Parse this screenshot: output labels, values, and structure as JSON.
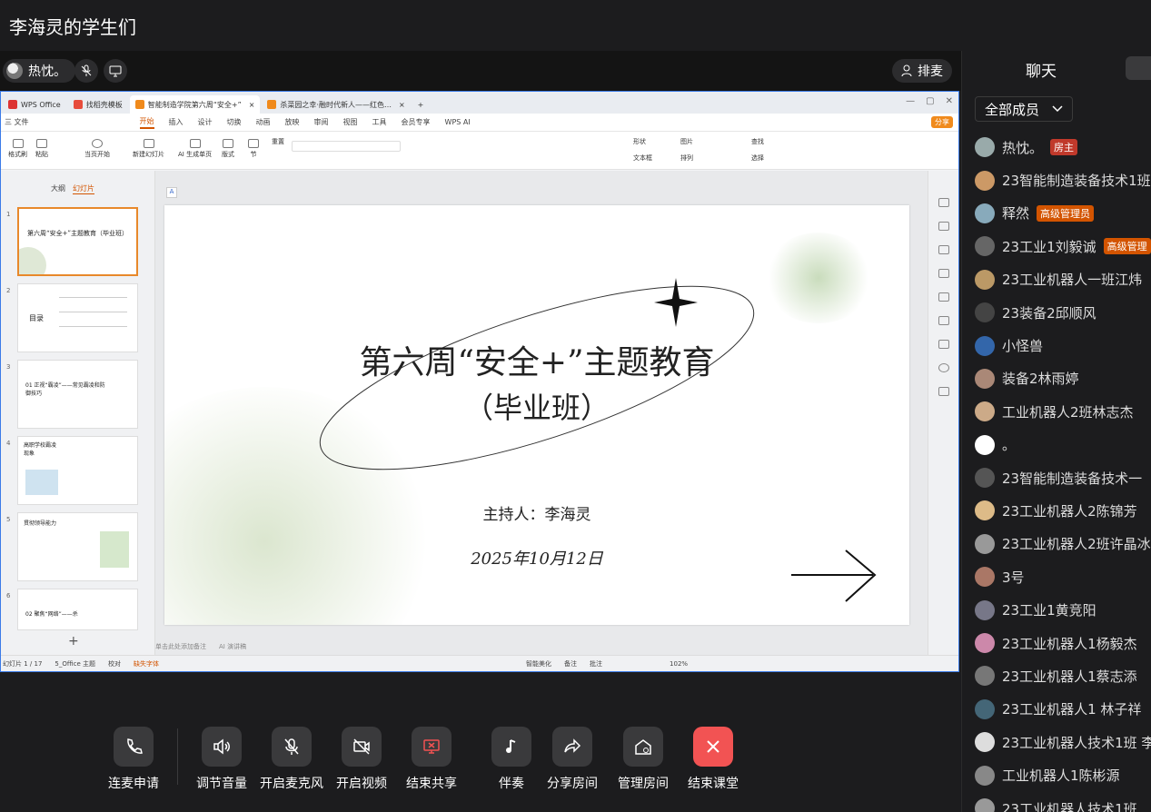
{
  "room": {
    "title": "李海灵的学生们"
  },
  "topbar": {
    "host_name": "热忱。",
    "queue_label": "排麦"
  },
  "wps": {
    "tabs": [
      {
        "label": "WPS Office",
        "color": "#d33"
      },
      {
        "label": "找稻壳模板",
        "color": "#e74c3c"
      },
      {
        "label": "智能制造学院第六周“安全+”",
        "color": "#f08a1c"
      },
      {
        "label": "杀菜园之幸·融时代新人——红色…",
        "color": "#f08a1c"
      }
    ],
    "menu": [
      "三 文件",
      "开始",
      "插入",
      "设计",
      "切换",
      "动画",
      "放映",
      "审阅",
      "视图",
      "工具",
      "会员专享",
      "WPS AI"
    ],
    "active_menu": "开始",
    "share_label": "分享",
    "ribbon": [
      "格式刷",
      "粘贴",
      "当页开始",
      "新建幻灯片",
      "AI 生成单页",
      "版式",
      "节",
      "重置",
      "形状",
      "图片",
      "文本框",
      "排列",
      "查找",
      "选择"
    ],
    "panel_tabs": [
      "大纲",
      "幻灯片"
    ],
    "thumbnails": [
      {
        "num": "1",
        "text": "第六周“安全+”主题教育（毕业班）"
      },
      {
        "num": "2",
        "text": "目录"
      },
      {
        "num": "3",
        "text": "01 正视“霸凌”——常见霸凌和防御技巧"
      },
      {
        "num": "4",
        "text": "高职学校霸凌现象"
      },
      {
        "num": "5",
        "text": "贯彻领导能力"
      },
      {
        "num": "6",
        "text": "02 聚焦“网络”——杀"
      }
    ],
    "slide": {
      "title": "第六周“安全+”主题教育",
      "subtitle": "（毕业班）",
      "host": "主持人：李海灵",
      "date": "2025年10月12日"
    },
    "notes_hint": "单击此处添加备注",
    "ai_label": "AI 演讲稿",
    "status": {
      "slide_count": "幻灯片 1 / 17",
      "theme": "5_Office 主题",
      "proof": "校对",
      "missing_font": "缺失字体",
      "smart": "智能美化",
      "notes": "备注",
      "comments": "批注",
      "zoom": "102%"
    }
  },
  "toolbar": [
    {
      "label": "连麦申请",
      "icon": "phone-icon"
    },
    {
      "label": "调节音量",
      "icon": "speaker-icon"
    },
    {
      "label": "开启麦克风",
      "icon": "mic-off-icon"
    },
    {
      "label": "开启视频",
      "icon": "video-off-icon"
    },
    {
      "label": "结束共享",
      "icon": "screen-share-icon"
    },
    {
      "label": "伴奏",
      "icon": "music-icon"
    },
    {
      "label": "分享房间",
      "icon": "share-icon"
    },
    {
      "label": "管理房间",
      "icon": "home-gear-icon"
    },
    {
      "label": "结束课堂",
      "icon": "close-icon"
    }
  ],
  "panel": {
    "chat_tab": "聊天",
    "filter_label": "全部成员",
    "members": [
      {
        "name": "热忱。",
        "tag": "房主",
        "tag_color": "#c0392b",
        "avatar": "#9aa"
      },
      {
        "name": "23智能制造装备技术1班",
        "tag": "",
        "avatar": "#c96"
      },
      {
        "name": "释然",
        "tag": "高级管理员",
        "tag_color": "#d35400",
        "avatar": "#8ab"
      },
      {
        "name": "23工业1刘毅诚",
        "tag": "高级管理",
        "tag_color": "#d35400",
        "avatar": "#666"
      },
      {
        "name": "23工业机器人一班江炜",
        "tag": "",
        "avatar": "#b96"
      },
      {
        "name": "23装备2邱顺风",
        "tag": "",
        "avatar": "#444"
      },
      {
        "name": "小怪兽",
        "tag": "",
        "avatar": "#36a"
      },
      {
        "name": "装备2林雨婷",
        "tag": "",
        "avatar": "#a87"
      },
      {
        "name": "工业机器人2班林志杰",
        "tag": "",
        "avatar": "#ca8"
      },
      {
        "name": "。",
        "tag": "",
        "avatar": "#fff"
      },
      {
        "name": "23智能制造装备技术一",
        "tag": "",
        "avatar": "#555"
      },
      {
        "name": "23工业机器人2陈锦芳",
        "tag": "",
        "avatar": "#db8"
      },
      {
        "name": "23工业机器人2班许晶冰",
        "tag": "",
        "avatar": "#999"
      },
      {
        "name": "3号",
        "tag": "",
        "avatar": "#a76"
      },
      {
        "name": "23工业1黄竞阳",
        "tag": "",
        "avatar": "#778"
      },
      {
        "name": "23工业机器人1杨毅杰",
        "tag": "",
        "avatar": "#c8a"
      },
      {
        "name": "23工业机器人1蔡志添",
        "tag": "",
        "avatar": "#777"
      },
      {
        "name": "23工业机器人1 林子祥",
        "tag": "",
        "avatar": "#467"
      },
      {
        "name": "23工业机器人技术1班 李",
        "tag": "",
        "avatar": "#ddd"
      },
      {
        "name": "工业机器人1陈彬源",
        "tag": "",
        "avatar": "#888"
      },
      {
        "name": "23工业机器人技术1班",
        "tag": "",
        "avatar": "#999"
      }
    ]
  }
}
